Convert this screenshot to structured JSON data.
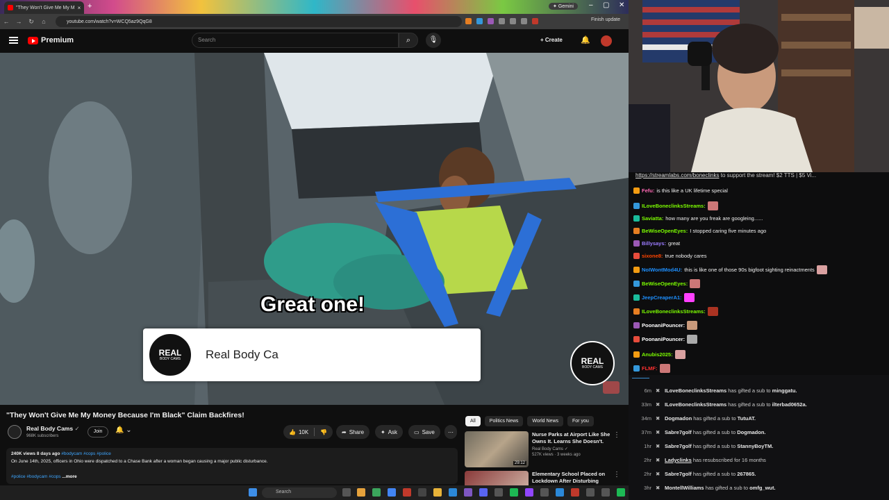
{
  "browser": {
    "tab_title": "\"They Won't Give Me My M",
    "url": "youtube.com/watch?v=WCQ5az9QqG8",
    "gemini_label": "Gemini",
    "finish_update_label": "Finish update"
  },
  "youtube": {
    "logo_label": "Premium",
    "search_placeholder": "Search",
    "create_label": "Create"
  },
  "video": {
    "caption": "Great one!",
    "brand_card_name": "Real Body Ca",
    "logo_line1": "REAL",
    "logo_line2": "BODY CAMS",
    "title": "\"They Won't Give Me My Money Because I'm Black\" Claim Backfires!",
    "channel": "Real Body Cams",
    "subscribers": "968K subscribers",
    "join_label": "Join",
    "likes": "10K",
    "share_label": "Share",
    "ask_label": "Ask",
    "save_label": "Save",
    "views_date": "240K views  8 days ago",
    "hashtags": "#bodycam #cops #police",
    "description": "On June 14th, 2025, officers in Ohio were dispatched to a Chase Bank after a woman began causing a major public disturbance.",
    "description_tags": "#police #bodycam #cops",
    "more_label": "...more"
  },
  "chips": [
    "All",
    "Politics News",
    "World News",
    "For you"
  ],
  "recommended": [
    {
      "title": "Nurse Parks at Airport Like She Owns It. Learns She Doesn't.",
      "channel": "Real Body Cams",
      "meta": "527K views · 3 weeks ago",
      "duration": "29:12"
    },
    {
      "title": "Elementary School Placed on Lockdown After Disturbing",
      "channel": "",
      "meta": "",
      "duration": ""
    }
  ],
  "chat": {
    "banner_link": "https://streamlabs.com/boneclinks",
    "banner_text": " to support the stream! $2 TTS | $5 Vi...",
    "messages": [
      {
        "user": "Fefu",
        "color": "#ff69b4",
        "text": "is this like a UK lifetime special"
      },
      {
        "user": "ILoveBoneclinksStreams",
        "color": "#7cfc00",
        "text": ""
      },
      {
        "user": "Saviatta",
        "color": "#7cfc00",
        "text": "how many are you freak are googleing......"
      },
      {
        "user": "BeWiseOpenEyes",
        "color": "#7cfc00",
        "text": "I stopped caring five minutes ago"
      },
      {
        "user": "Billysays",
        "color": "#9b7bff",
        "text": "great"
      },
      {
        "user": "sixone8",
        "color": "#ff4500",
        "text": "true nobody cares"
      },
      {
        "user": "NoIWontMod4U",
        "color": "#1e90ff",
        "text": "this is like one of those 90s bigfoot sighting reinactments"
      },
      {
        "user": "BeWiseOpenEyes",
        "color": "#7cfc00",
        "text": ""
      },
      {
        "user": "JeepCreaperA1",
        "color": "#1e90ff",
        "text": ""
      },
      {
        "user": "ILoveBoneclinksStreams",
        "color": "#7cfc00",
        "text": ""
      },
      {
        "user": "PoonaniPouncer",
        "color": "#ffffff",
        "text": ""
      },
      {
        "user": "PoonaniPouncer",
        "color": "#ffffff",
        "text": ""
      },
      {
        "user": "Anubis2025",
        "color": "#7cfc00",
        "text": ""
      },
      {
        "user": "FLMF",
        "color": "#ff3030",
        "text": ""
      }
    ]
  },
  "events": [
    {
      "time": "6m",
      "user": "ILoveBoneclinksStreams",
      "text": "has gifted a sub to ",
      "target": "minggatu."
    },
    {
      "time": "33m",
      "user": "ILoveBoneclinksStreams",
      "text": "has gifted a sub to ",
      "target": "ilterbad0652a."
    },
    {
      "time": "34m",
      "user": "Dogmadon",
      "text": "has gifted a sub to ",
      "target": "TutuAT."
    },
    {
      "time": "37m",
      "user": "Sabre7golf",
      "text": "has gifted a sub to ",
      "target": "Dogmadon."
    },
    {
      "time": "1hr",
      "user": "Sabre7golf",
      "text": "has gifted a sub to ",
      "target": "StannyBoyTM."
    },
    {
      "time": "2hr",
      "user": "Ladyclinks",
      "text": "has resubscribed for 16 months",
      "target": ""
    },
    {
      "time": "2hr",
      "user": "Sabre7golf",
      "text": "has gifted a sub to ",
      "target": "267865."
    },
    {
      "time": "3hr",
      "user": "MontellWilliams",
      "text": "has gifted a sub to ",
      "target": "omfg_wut."
    }
  ],
  "taskbar": {
    "search_label": "Search"
  },
  "colors": {
    "youtube_red": "#ff0000",
    "link_blue": "#3ea6ff"
  }
}
